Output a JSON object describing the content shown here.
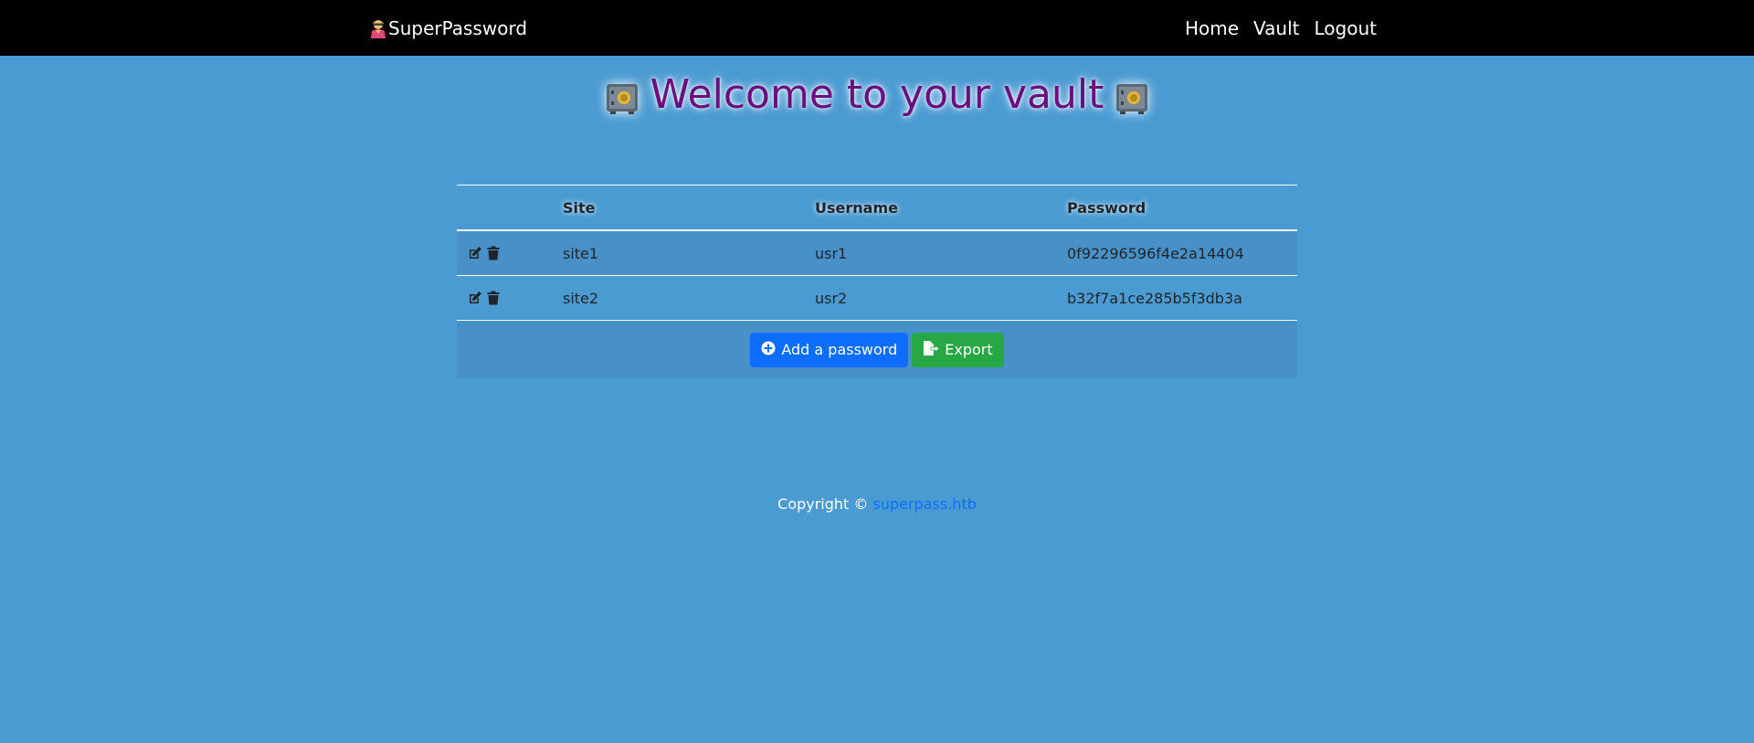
{
  "navbar": {
    "brand_label": "SuperPassword",
    "brand_icon": "superhero-icon",
    "links": [
      {
        "label": "Home"
      },
      {
        "label": "Vault"
      },
      {
        "label": "Logout"
      }
    ]
  },
  "heading": {
    "text": "Welcome to your vault",
    "icon": "safe-icon"
  },
  "table": {
    "columns": [
      "",
      "Site",
      "Username",
      "Password"
    ],
    "rows": [
      {
        "site": "site1",
        "username": "usr1",
        "password": "0f92296596f4e2a14404"
      },
      {
        "site": "site2",
        "username": "usr2",
        "password": "b32f7a1ce285b5f3db3a"
      }
    ],
    "add_button_label": "Add a password",
    "export_button_label": "Export"
  },
  "footer": {
    "copyright_prefix": "Copyright ©",
    "link_text": "superpass.htb"
  },
  "colors": {
    "page_bg": "#4b9bd3",
    "navbar_bg": "#000000",
    "heading": "#6b0f7f",
    "primary": "#0d6efd",
    "success": "#28a745"
  }
}
